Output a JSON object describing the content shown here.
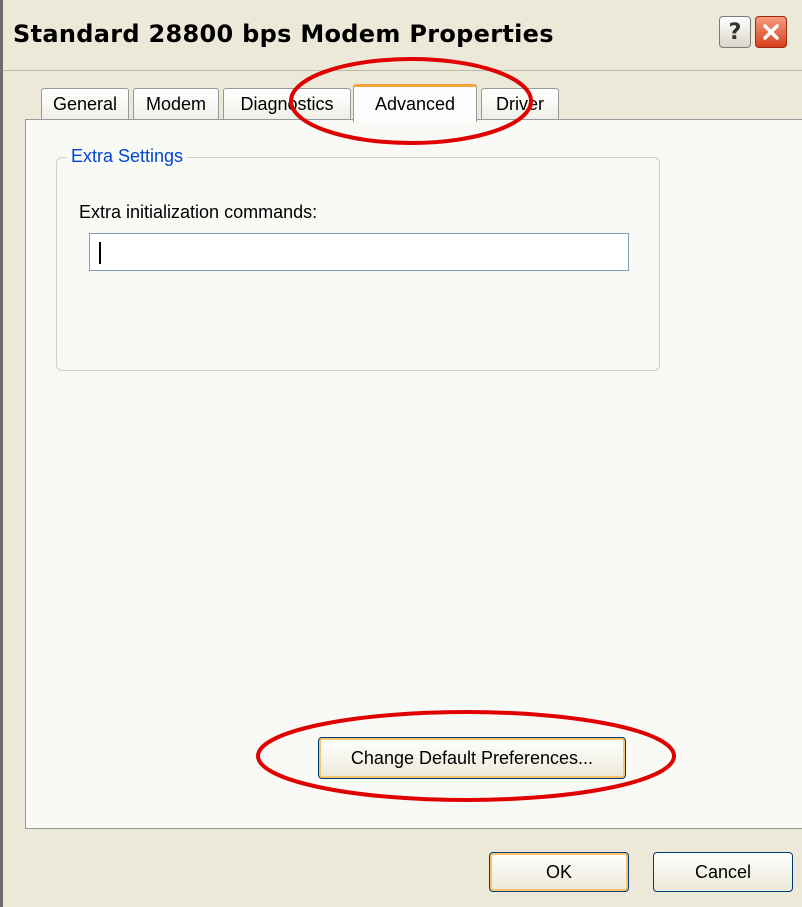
{
  "window": {
    "title": "Standard 28800 bps Modem Properties",
    "help_button": "?",
    "close_icon": "close-x-icon"
  },
  "tabs": [
    {
      "label": "General",
      "active": false
    },
    {
      "label": "Modem",
      "active": false
    },
    {
      "label": "Diagnostics",
      "active": false
    },
    {
      "label": "Advanced",
      "active": true
    },
    {
      "label": "Driver",
      "active": false
    }
  ],
  "extra_settings": {
    "legend": "Extra Settings",
    "field_label": "Extra initialization commands:",
    "field_value": ""
  },
  "buttons": {
    "change_defaults": "Change Default Preferences...",
    "ok": "OK",
    "cancel": "Cancel"
  },
  "colors": {
    "annotation": "#e00000",
    "legend_text": "#0046d5",
    "close_button": "#d8401c"
  }
}
